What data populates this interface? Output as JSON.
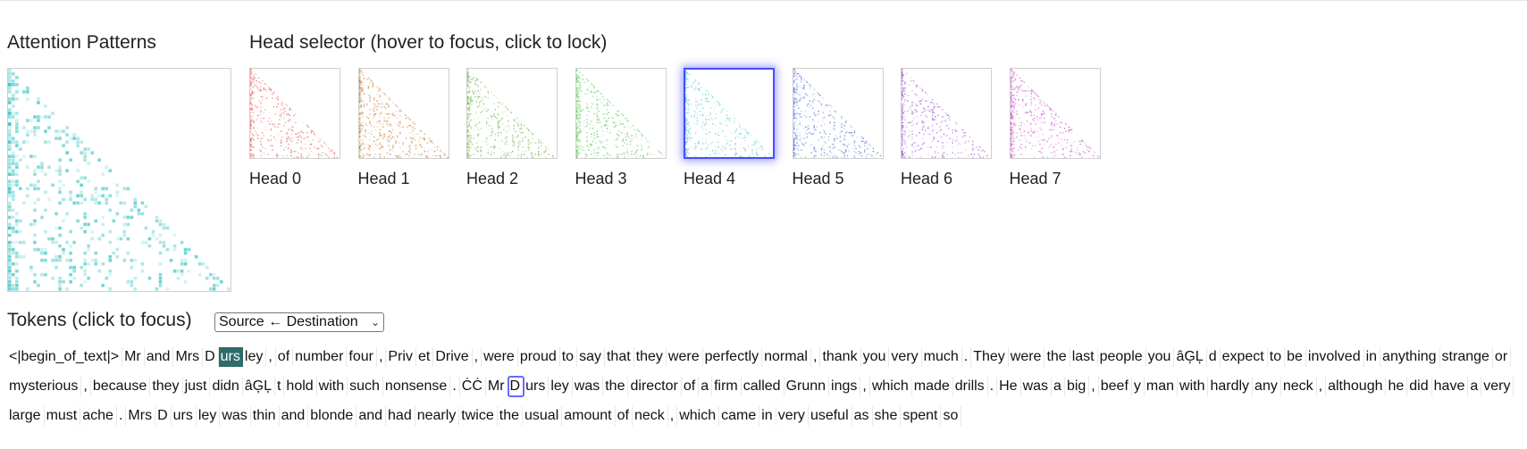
{
  "attention": {
    "title": "Attention Patterns"
  },
  "heads": {
    "title": "Head selector",
    "subtitle": "(hover to focus, click to lock)",
    "selected_index": 4,
    "items": [
      {
        "label": "Head 0",
        "color": "#e0404a"
      },
      {
        "label": "Head 1",
        "color": "#b86a18"
      },
      {
        "label": "Head 2",
        "color": "#5aa82a"
      },
      {
        "label": "Head 3",
        "color": "#3cc03c"
      },
      {
        "label": "Head 4",
        "color": "#2fbfbf"
      },
      {
        "label": "Head 5",
        "color": "#3a56c8"
      },
      {
        "label": "Head 6",
        "color": "#8a3ad0"
      },
      {
        "label": "Head 7",
        "color": "#c030c0"
      }
    ]
  },
  "tokens": {
    "title": "Tokens",
    "subtitle": "(click to focus)",
    "direction_select": {
      "value": "Source ← Destination",
      "icon": "chevron-down-icon"
    },
    "lines": [
      [
        "<|begin_of_text|>",
        "Mr",
        " and",
        " Mrs",
        " D",
        "urs",
        "ley",
        ",",
        " of",
        " number",
        " four",
        ",",
        " Priv",
        "et",
        " Drive",
        ",",
        " were",
        " proud",
        " to",
        " say",
        " that",
        " they",
        " were",
        " perfectly",
        " normal",
        ",",
        " thank",
        " you",
        " very",
        " much",
        ".",
        " They",
        " were",
        " the",
        " last",
        " people",
        " you",
        "âĢĻ",
        "d",
        " expect",
        " to",
        " be",
        " involved",
        " in",
        " anything",
        " strange",
        " or"
      ],
      [
        " mysterious",
        ",",
        " because",
        " they",
        " just",
        " didn",
        "âĢĻ",
        "t",
        " hold",
        " with",
        " such",
        " nonsense",
        ".",
        "ĊĊ",
        "Mr",
        " D",
        "urs",
        "ley",
        " was",
        " the",
        " director",
        " of",
        " a",
        " firm",
        " called",
        " Grunn",
        "ings",
        ",",
        " which",
        " made",
        " drills",
        ".",
        " He",
        " was",
        " a",
        " big",
        ",",
        " beef",
        "y",
        " man",
        " with",
        " hardly",
        " any",
        " neck",
        ",",
        " although",
        " he",
        " did",
        " have",
        " a",
        " very"
      ],
      [
        " large",
        " must",
        "ache",
        ".",
        " Mrs",
        " D",
        "urs",
        "ley",
        " was",
        " thin",
        " and",
        " blonde",
        " and",
        " had",
        " nearly",
        " twice",
        " the",
        " usual",
        " amount",
        " of",
        " neck",
        ",",
        " which",
        " came",
        " in",
        " very",
        " useful",
        " as",
        " she",
        " spent",
        " so"
      ]
    ],
    "focused": {
      "line": 0,
      "index": 5
    },
    "hovered": {
      "line": 1,
      "index": 15
    }
  },
  "colors": {
    "focus_bg": "#2f6b6b",
    "hover_outline": "#6a6aff",
    "selected_glow": "#4b4bff"
  }
}
